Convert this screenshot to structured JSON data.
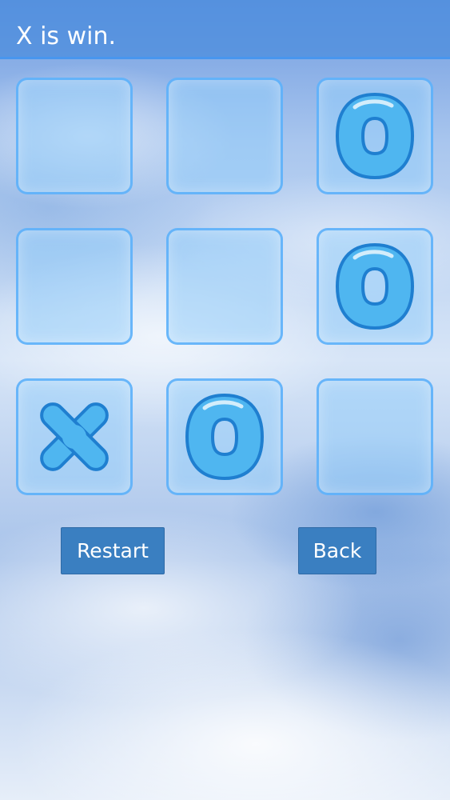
{
  "status": {
    "text": "X is win."
  },
  "board": {
    "cells": [
      {
        "mark": ""
      },
      {
        "mark": ""
      },
      {
        "mark": "O"
      },
      {
        "mark": ""
      },
      {
        "mark": ""
      },
      {
        "mark": "O"
      },
      {
        "mark": "X"
      },
      {
        "mark": "O"
      },
      {
        "mark": ""
      }
    ]
  },
  "buttons": {
    "restart_label": "Restart",
    "back_label": "Back"
  },
  "colors": {
    "header": "#4e8ede",
    "button": "#3a7fc1",
    "piece": "#4fb6f0",
    "piece_outline": "#1f7fd0"
  }
}
